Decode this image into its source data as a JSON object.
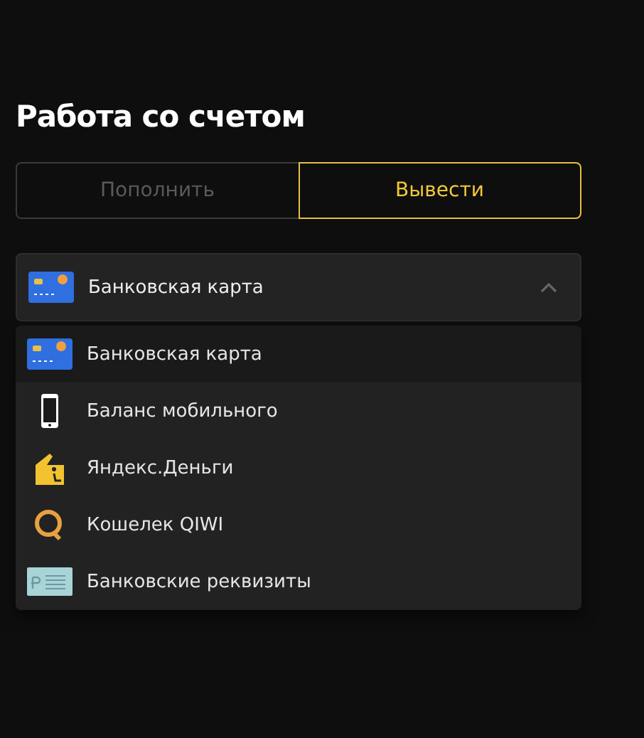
{
  "title": "Работа со счетом",
  "tabs": [
    {
      "label": "Пополнить",
      "selected": false
    },
    {
      "label": "Вывести",
      "selected": true
    }
  ],
  "method_select": {
    "value": "Банковская карта",
    "kind": "card",
    "expanded": true
  },
  "options": [
    {
      "label": "Банковская карта",
      "kind": "card",
      "selected": true
    },
    {
      "label": "Баланс мобильного",
      "kind": "phone",
      "selected": false
    },
    {
      "label": "Яндекс.Деньги",
      "kind": "wallet",
      "selected": false
    },
    {
      "label": "Кошелек QIWI",
      "kind": "qiwi",
      "selected": false
    },
    {
      "label": "Банковские реквизиты",
      "kind": "requisites",
      "selected": false
    }
  ]
}
